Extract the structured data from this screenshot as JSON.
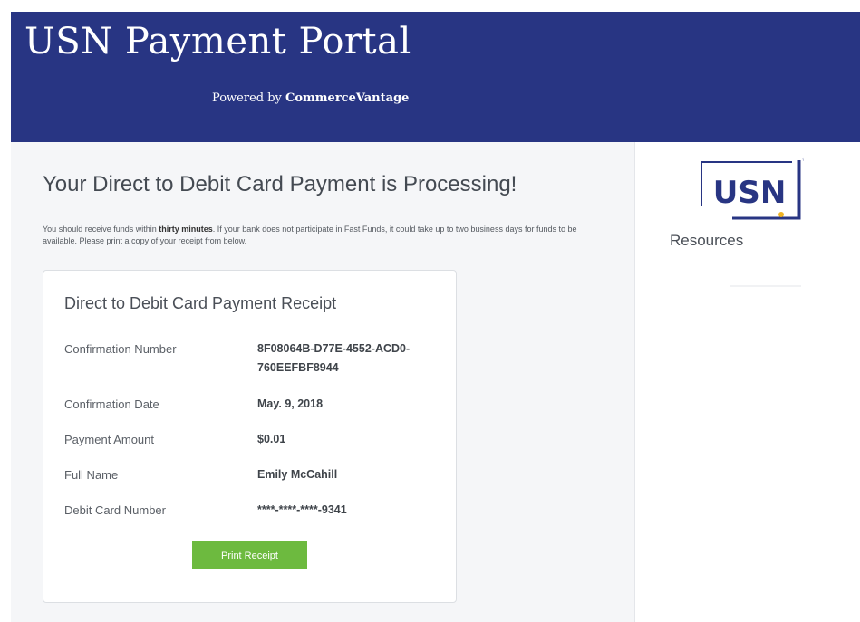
{
  "header": {
    "title": "USN Payment Portal",
    "powered_prefix": "Powered by ",
    "powered_brand": "CommerceVantage"
  },
  "main": {
    "heading": "Your Direct to Debit Card Payment is Processing!",
    "intro": {
      "part1": "You should receive funds within ",
      "bold": "thirty minutes",
      "part2": ". If your bank does not participate in Fast Funds, it could take up to two business days for funds to be available. Please print a copy of your receipt from below."
    }
  },
  "receipt": {
    "title": "Direct to Debit Card Payment Receipt",
    "rows": [
      {
        "label": "Confirmation Number",
        "value": "8F08064B-D77E-4552-ACD0-760EEFBF8944"
      },
      {
        "label": "Confirmation Date",
        "value": "May. 9, 2018"
      },
      {
        "label": "Payment Amount",
        "value": "$0.01"
      },
      {
        "label": "Full Name",
        "value": "Emily McCahill"
      },
      {
        "label": "Debit Card Number",
        "value": "****-****-****-9341"
      }
    ],
    "print_label": "Print Receipt"
  },
  "sidebar": {
    "logo_text": "USN",
    "logo_mark": "®",
    "resources_label": "Resources"
  },
  "colors": {
    "header_bg": "#283583",
    "button_green": "#6dba3f",
    "logo_blue": "#283583",
    "logo_dot": "#f0b323"
  }
}
